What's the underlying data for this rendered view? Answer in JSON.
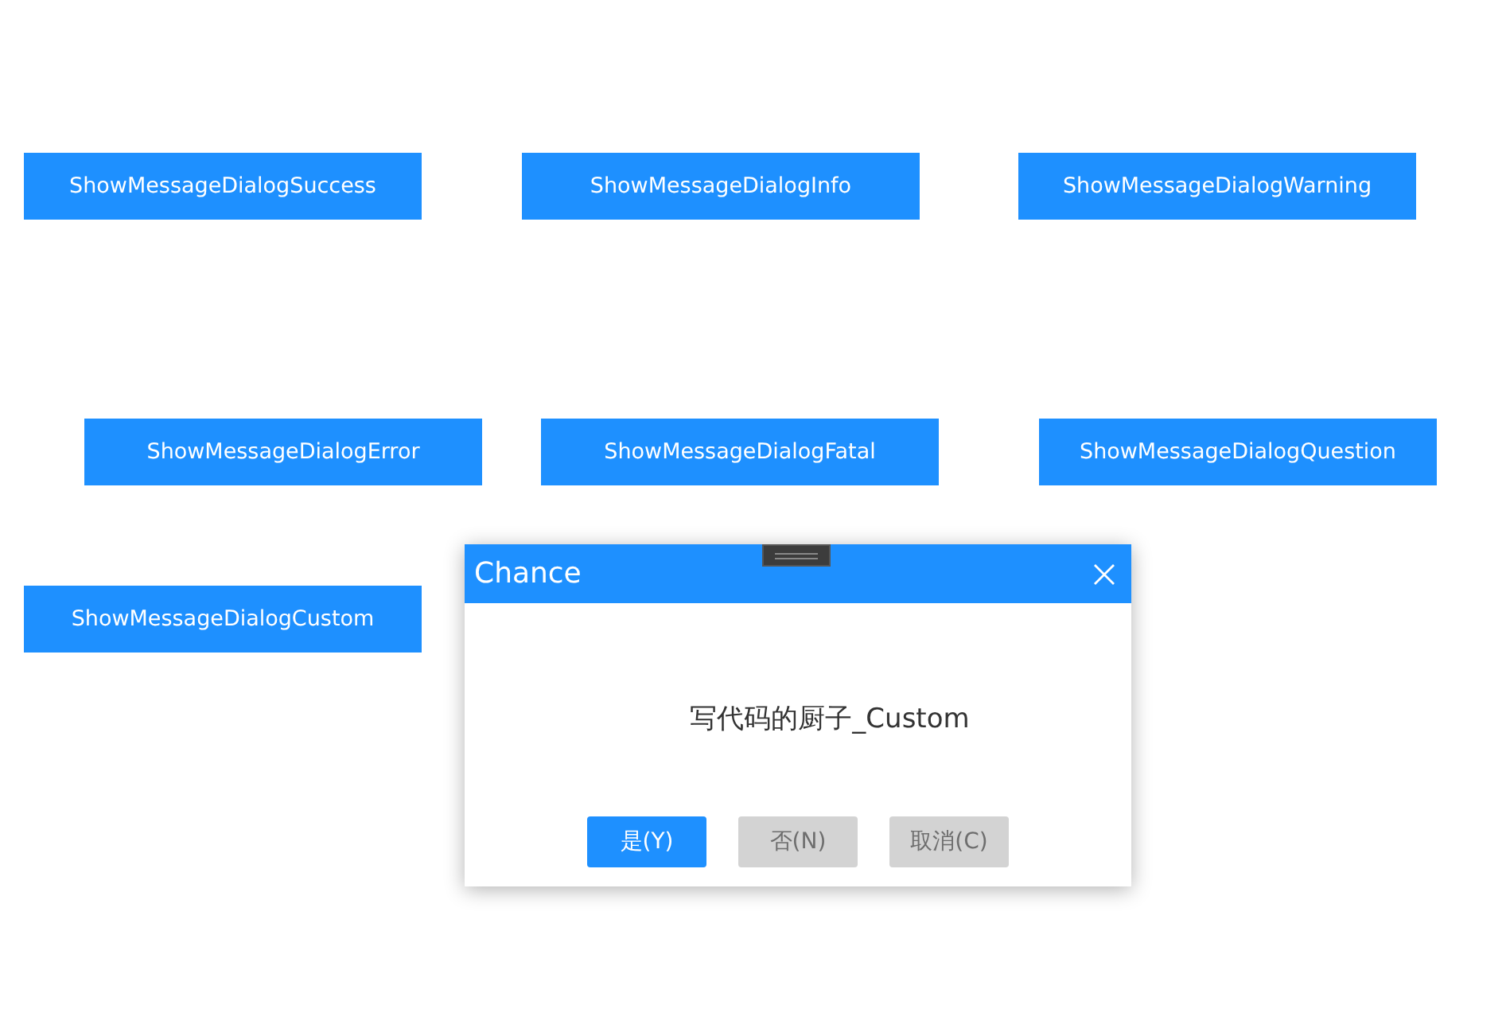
{
  "buttons": [
    {
      "label": "ShowMessageDialogSuccess"
    },
    {
      "label": "ShowMessageDialogInfo"
    },
    {
      "label": "ShowMessageDialogWarning"
    },
    {
      "label": "ShowMessageDialogError"
    },
    {
      "label": "ShowMessageDialogFatal"
    },
    {
      "label": "ShowMessageDialogQuestion"
    },
    {
      "label": "ShowMessageDialogCustom"
    }
  ],
  "dialog": {
    "title": "Chance",
    "message": "写代码的厨子_Custom",
    "buttons": [
      {
        "label": "是(Y)",
        "kind": "primary"
      },
      {
        "label": "否(N)",
        "kind": "secondary"
      },
      {
        "label": "取消(C)",
        "kind": "secondary"
      }
    ]
  }
}
